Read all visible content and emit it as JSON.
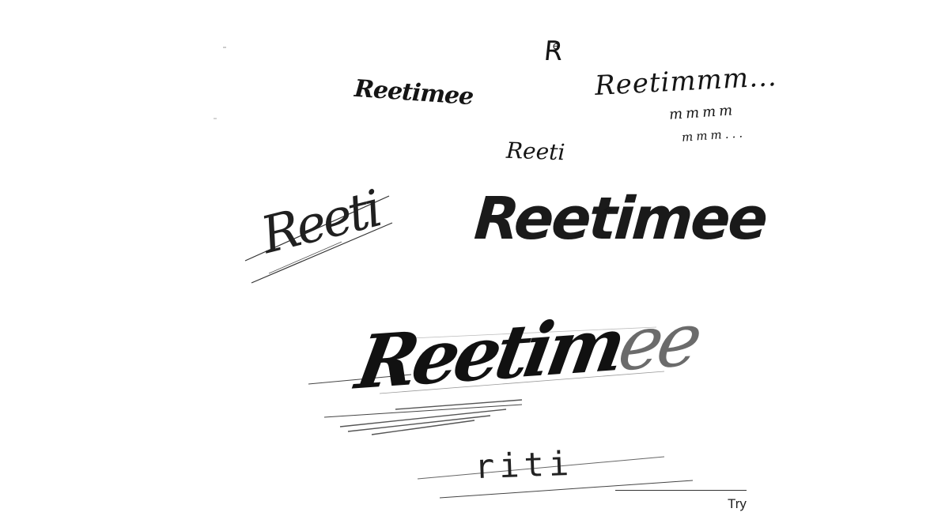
{
  "sketches": {
    "monogram": "R",
    "monogram_small": "e",
    "script_top": "Reetimee",
    "handwritten": "Reetimmm...",
    "handwritten_line2": "mmmm",
    "handwritten_line3": "mmm...",
    "small_reeti": "Reeti",
    "logo": "Reetimee",
    "sketch_reeti": "Reeti",
    "shaded_main": "Reetim",
    "shaded_faint": "ee",
    "riti": "riti"
  },
  "footer": {
    "try_label": "Try"
  },
  "colors": {
    "background": "#ffffff",
    "ink": "#151515"
  }
}
